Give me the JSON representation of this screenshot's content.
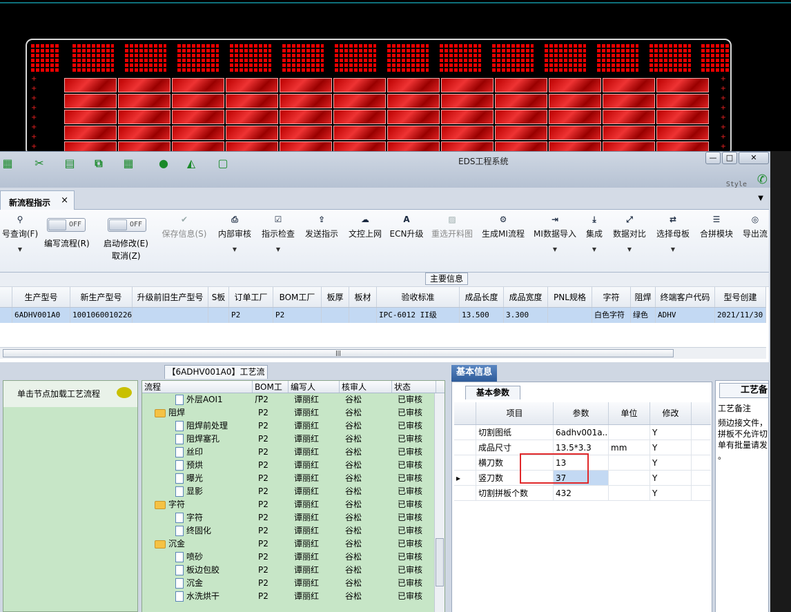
{
  "window": {
    "title": "EDS工程系统",
    "style_label": "Style"
  },
  "tab": {
    "label": "新流程指示",
    "close": "×"
  },
  "ribbon": {
    "query": "号查询(F)",
    "toggle1": "OFF",
    "toggle1_label": "编写流程(R)",
    "toggle2": "OFF",
    "toggle2_label": "启动修改(E)",
    "cancel": "取消(Z)",
    "buttons": [
      "保存信息(S)",
      "内部审核",
      "指示检查",
      "发送指示",
      "文控上网",
      "ECN升级",
      "重选开料图",
      "生成MI流程",
      "MI数据导入",
      "集成",
      "数据对比",
      "选择母板",
      "合拼模块",
      "导出流"
    ]
  },
  "main_info": {
    "tab": "主要信息",
    "columns": [
      "生产型号",
      "新生产型号",
      "升级前旧生产型号",
      "S板",
      "订单工厂",
      "BOM工厂",
      "板厚",
      "板材",
      "验收标准",
      "成品长度",
      "成品宽度",
      "PNL规格",
      "字符",
      "阻焊",
      "终端客户代码",
      "型号创建"
    ],
    "row": [
      "6ADHV001A0",
      "10010600102264",
      "",
      "",
      "P2",
      "P2",
      "",
      "",
      "IPC-6012 II级",
      "13.500",
      "3.300",
      "",
      "白色字符",
      "绿色",
      "ADHV",
      "2021/11/30"
    ]
  },
  "left_panel": {
    "hint": "单击节点加载工艺流程"
  },
  "process": {
    "tab": "【6ADHV001A0】工艺流程",
    "columns": [
      "流程",
      "BOM工厂",
      "编写人",
      "核审人",
      "状态"
    ],
    "rows": [
      {
        "name": "外层AOI1",
        "type": "doc",
        "bom": "P2",
        "writer": "谭丽红",
        "checker": "谷松",
        "status": "已审核"
      },
      {
        "name": "阻焊",
        "type": "folder",
        "bom": "P2",
        "writer": "谭丽红",
        "checker": "谷松",
        "status": "已审核"
      },
      {
        "name": "阻焊前处理",
        "type": "doc",
        "bom": "P2",
        "writer": "谭丽红",
        "checker": "谷松",
        "status": "已审核"
      },
      {
        "name": "阻焊塞孔",
        "type": "doc",
        "bom": "P2",
        "writer": "谭丽红",
        "checker": "谷松",
        "status": "已审核"
      },
      {
        "name": "丝印",
        "type": "doc",
        "bom": "P2",
        "writer": "谭丽红",
        "checker": "谷松",
        "status": "已审核"
      },
      {
        "name": "预烘",
        "type": "doc",
        "bom": "P2",
        "writer": "谭丽红",
        "checker": "谷松",
        "status": "已审核"
      },
      {
        "name": "曝光",
        "type": "doc",
        "bom": "P2",
        "writer": "谭丽红",
        "checker": "谷松",
        "status": "已审核"
      },
      {
        "name": "显影",
        "type": "doc",
        "bom": "P2",
        "writer": "谭丽红",
        "checker": "谷松",
        "status": "已审核"
      },
      {
        "name": "字符",
        "type": "folder",
        "bom": "P2",
        "writer": "谭丽红",
        "checker": "谷松",
        "status": "已审核"
      },
      {
        "name": "字符",
        "type": "doc",
        "bom": "P2",
        "writer": "谭丽红",
        "checker": "谷松",
        "status": "已审核"
      },
      {
        "name": "终固化",
        "type": "doc",
        "bom": "P2",
        "writer": "谭丽红",
        "checker": "谷松",
        "status": "已审核"
      },
      {
        "name": "沉金",
        "type": "folder",
        "bom": "P2",
        "writer": "谭丽红",
        "checker": "谷松",
        "status": "已审核"
      },
      {
        "name": "喷砂",
        "type": "doc",
        "bom": "P2",
        "writer": "谭丽红",
        "checker": "谷松",
        "status": "已审核"
      },
      {
        "name": "板边包胶",
        "type": "doc",
        "bom": "P2",
        "writer": "谭丽红",
        "checker": "谷松",
        "status": "已审核"
      },
      {
        "name": "沉金",
        "type": "doc",
        "bom": "P2",
        "writer": "谭丽红",
        "checker": "谷松",
        "status": "已审核"
      },
      {
        "name": "水洗烘干",
        "type": "doc",
        "bom": "P2",
        "writer": "谭丽红",
        "checker": "谷松",
        "status": "已审核"
      }
    ]
  },
  "basic": {
    "tab": "基本信息",
    "subtab": "基本参数",
    "columns": [
      "项目",
      "参数",
      "单位",
      "修改"
    ],
    "rows": [
      [
        "切割图纸",
        "6adhv001a...",
        "",
        "Y"
      ],
      [
        "成品尺寸",
        "13.5*3.3",
        "mm",
        "Y"
      ],
      [
        "横刀数",
        "13",
        "",
        "Y"
      ],
      [
        "竖刀数",
        "37",
        "",
        "Y"
      ],
      [
        "切割拼板个数",
        "432",
        "",
        "Y"
      ]
    ]
  },
  "right_panel": {
    "tab": "工艺备",
    "header": "工艺备注",
    "lines": [
      "频边接文件，",
      "拼板不允许切割",
      "单有批量请发给",
      "。"
    ]
  }
}
